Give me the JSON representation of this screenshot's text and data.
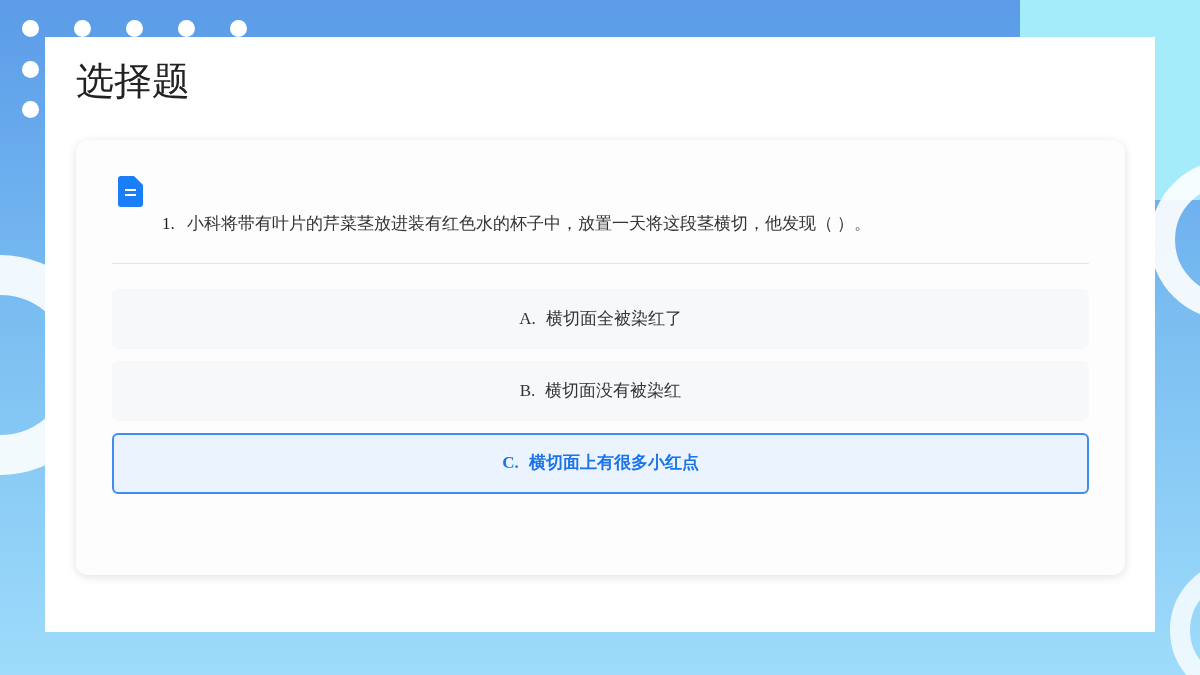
{
  "title": "选择题",
  "question": {
    "number": "1.",
    "text": "小科将带有叶片的芹菜茎放进装有红色水的杯子中，放置一天将这段茎横切，他发现（ ）。"
  },
  "options": [
    {
      "letter": "A.",
      "text": "横切面全被染红了",
      "selected": false
    },
    {
      "letter": "B.",
      "text": "横切面没有被染红",
      "selected": false
    },
    {
      "letter": "C.",
      "text": "横切面上有很多小红点",
      "selected": true
    }
  ]
}
